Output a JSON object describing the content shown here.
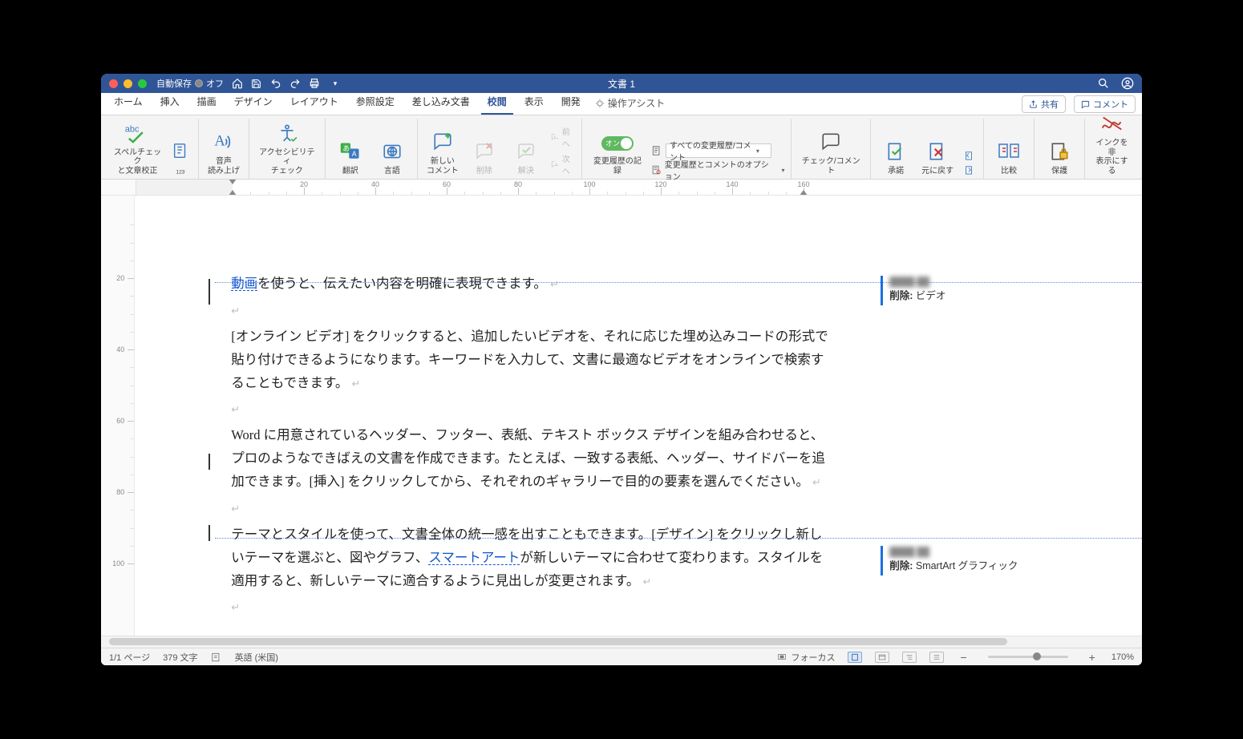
{
  "titlebar": {
    "autosave_label": "自動保存",
    "autosave_state": "オフ",
    "doc_title": "文書 1"
  },
  "tabs": {
    "items": [
      "ホーム",
      "挿入",
      "描画",
      "デザイン",
      "レイアウト",
      "参照設定",
      "差し込み文書",
      "校閲",
      "表示",
      "開発"
    ],
    "active_index": 7,
    "tell_me": "操作アシスト",
    "share": "共有",
    "comments": "コメント"
  },
  "ribbon": {
    "proofing": {
      "spellcheck": "スペルチェック\nと文章校正",
      "wordcount_icon": "abc"
    },
    "speech": {
      "read_aloud": "音声\n読み上げ"
    },
    "a11y": {
      "check": "アクセシビリティ\nチェック"
    },
    "language": {
      "translate": "翻訳",
      "language": "言語"
    },
    "comments": {
      "new": "新しい\nコメント",
      "delete": "削除",
      "resolve": "解決",
      "prev": "前へ",
      "next": "次へ"
    },
    "tracking": {
      "toggle_text": "オン",
      "record": "変更履歴の記録",
      "markup_select": "すべての変更履歴/コメント",
      "markup_options": "変更履歴とコメントのオプション"
    },
    "changes": {
      "review": "チェック/コメント",
      "accept": "承諾",
      "reject": "元に戻す"
    },
    "compare": {
      "compare": "比較"
    },
    "protect": {
      "protect": "保護"
    },
    "ink": {
      "hide_ink": "インクを非\n表示にする"
    }
  },
  "document": {
    "p1_edited": "動画",
    "p1_rest": "を使うと、伝えたい内容を明確に表現できます。",
    "p2": "[オンライン ビデオ] をクリックすると、追加したいビデオを、それに応じた埋め込みコードの形式で貼り付けできるようになります。キーワードを入力して、文書に最適なビデオをオンラインで検索することもできます。",
    "p3": "Word に用意されているヘッダー、フッター、表紙、テキスト ボックス デザインを組み合わせると、プロのようなできばえの文書を作成できます。たとえば、一致する表紙、ヘッダー、サイドバーを追加できます。[挿入] をクリックしてから、それぞれのギャラリーで目的の要素を選んでください。",
    "p4a": "テーマとスタイルを使って、文書全体の統一感を出すこともできます。[デザイン] をクリックし新しいテーマを選ぶと、図やグラフ、",
    "p4_edited": "スマートアート",
    "p4b": "が新しいテーマに合わせて変わります。スタイルを適用すると、新しいテーマに適合するように見出しが変更されます。"
  },
  "revisions": {
    "c1_label": "削除:",
    "c1_text": "ビデオ",
    "c2_label": "削除:",
    "c2_text": "SmartArt グラフィック"
  },
  "status": {
    "page": "1/1 ページ",
    "words": "379 文字",
    "lang": "英語 (米国)",
    "focus": "フォーカス",
    "zoom": "170%"
  },
  "ruler": {
    "majors_mm": [
      20,
      40,
      60,
      80,
      100,
      120,
      140,
      160
    ],
    "vert_mm": [
      20,
      40,
      60,
      80,
      100
    ]
  }
}
